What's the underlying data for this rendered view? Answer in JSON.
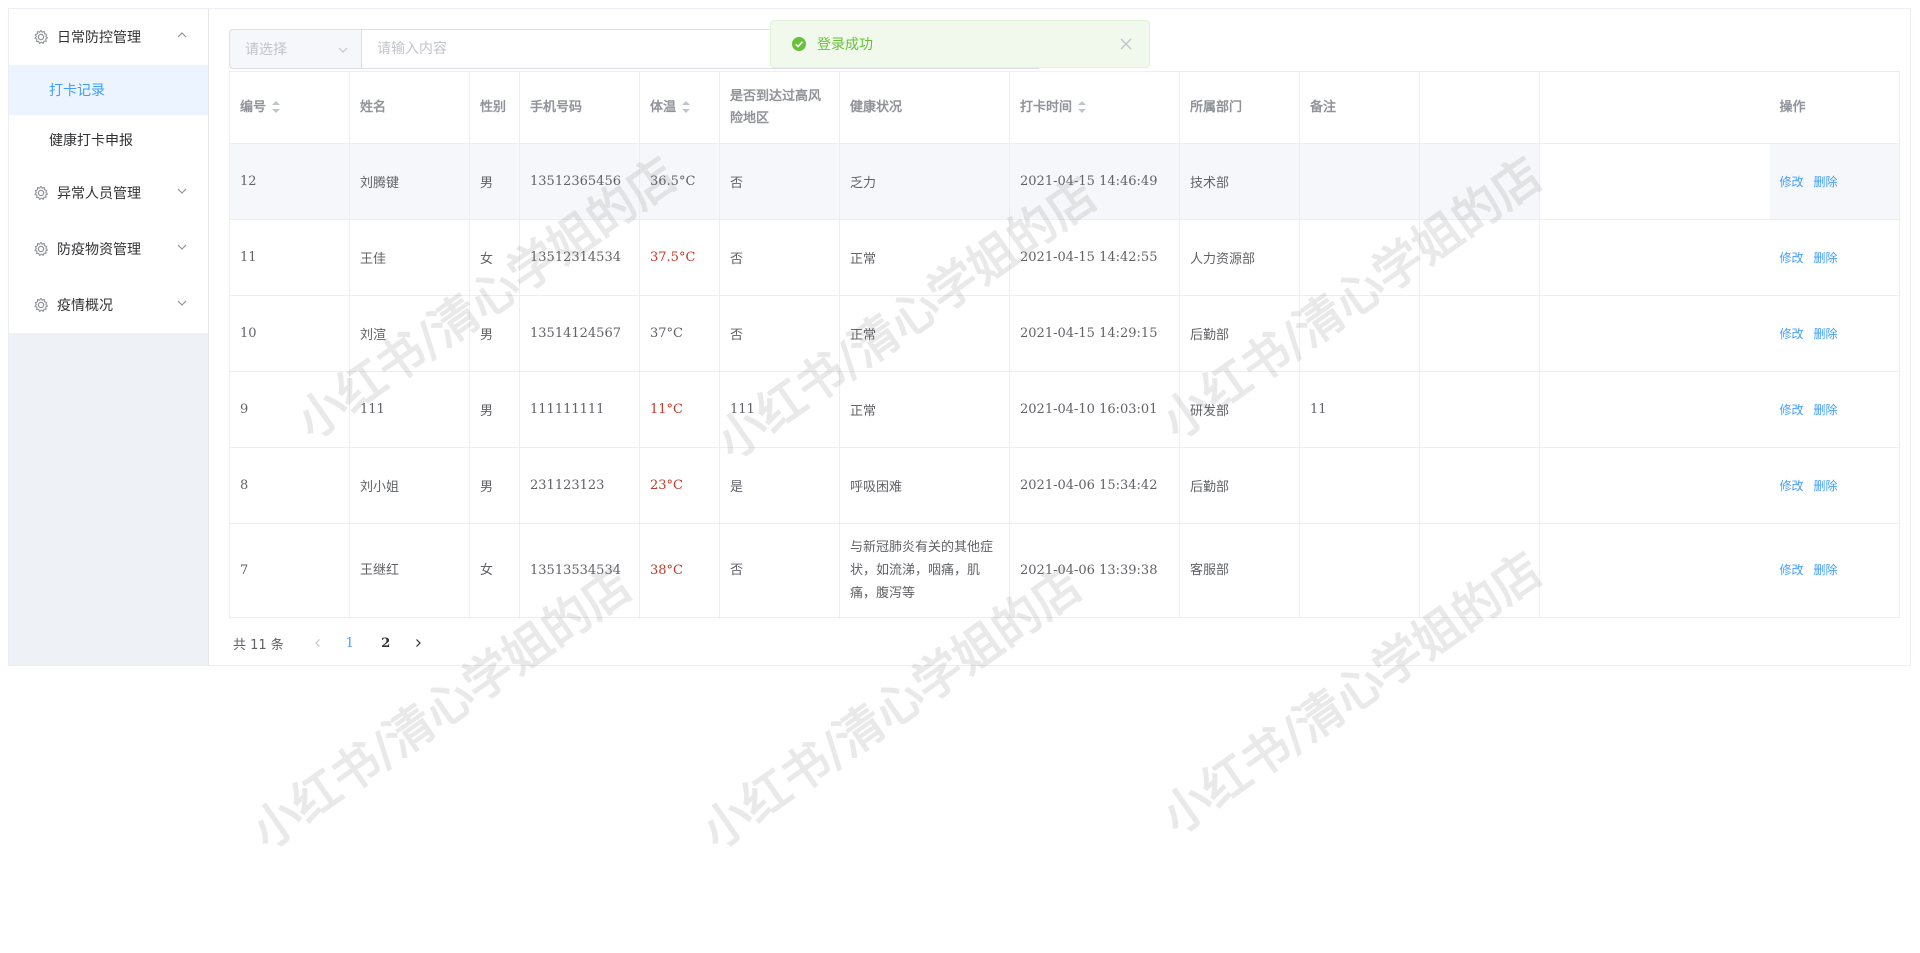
{
  "sidebar": {
    "groups": [
      {
        "label": "日常防控管理",
        "expanded": true,
        "children": [
          {
            "label": "打卡记录",
            "active": true
          },
          {
            "label": "健康打卡申报",
            "active": false
          }
        ]
      },
      {
        "label": "异常人员管理",
        "expanded": false
      },
      {
        "label": "防疫物资管理",
        "expanded": false
      },
      {
        "label": "疫情概况",
        "expanded": false
      }
    ]
  },
  "toolbar": {
    "select_placeholder": "请选择",
    "search_placeholder": "请输入内容"
  },
  "toast": {
    "message": "登录成功"
  },
  "table": {
    "headers": {
      "id": "编号",
      "name": "姓名",
      "gender": "性别",
      "phone": "手机号码",
      "temp": "体温",
      "risk": "是否到达过高风险地区",
      "health": "健康状况",
      "time": "打卡时间",
      "dept": "所属部门",
      "note": "备注",
      "ops": "操作"
    },
    "rows": [
      {
        "id": "12",
        "name": "刘腾键",
        "gender": "男",
        "phone": "13512365456",
        "temp": "36.5°C",
        "hot": false,
        "risk": "否",
        "health": "乏力",
        "time": "2021-04-15 14:46:49",
        "dept": "技术部",
        "note": ""
      },
      {
        "id": "11",
        "name": "王佳",
        "gender": "女",
        "phone": "13512314534",
        "temp": "37.5°C",
        "hot": true,
        "risk": "否",
        "health": "正常",
        "time": "2021-04-15 14:42:55",
        "dept": "人力资源部",
        "note": ""
      },
      {
        "id": "10",
        "name": "刘渲",
        "gender": "男",
        "phone": "13514124567",
        "temp": "37°C",
        "hot": false,
        "risk": "否",
        "health": "正常",
        "time": "2021-04-15 14:29:15",
        "dept": "后勤部",
        "note": ""
      },
      {
        "id": "9",
        "name": "111",
        "gender": "男",
        "phone": "111111111",
        "temp": "11°C",
        "hot": true,
        "risk": "111",
        "health": "正常",
        "time": "2021-04-10 16:03:01",
        "dept": "研发部",
        "note": "11"
      },
      {
        "id": "8",
        "name": "刘小姐",
        "gender": "男",
        "phone": "231123123",
        "temp": "23°C",
        "hot": true,
        "risk": "是",
        "health": "呼吸困难",
        "time": "2021-04-06 15:34:42",
        "dept": "后勤部",
        "note": ""
      },
      {
        "id": "7",
        "name": "王继红",
        "gender": "女",
        "phone": "13513534534",
        "temp": "38°C",
        "hot": true,
        "risk": "否",
        "health": "与新冠肺炎有关的其他症状，如流涕，咽痛，肌痛，腹泻等",
        "time": "2021-04-06 13:39:38",
        "dept": "客服部",
        "note": ""
      }
    ],
    "edit_label": "修改",
    "delete_label": "删除"
  },
  "pagination": {
    "total_text": "共 11 条",
    "pages": [
      "1",
      "2"
    ],
    "current": "1"
  },
  "watermark": {
    "text": "小红书/清心学姐的店"
  },
  "colors": {
    "accent": "#409eff",
    "success": "#67c23a",
    "danger": "#c0392b"
  }
}
